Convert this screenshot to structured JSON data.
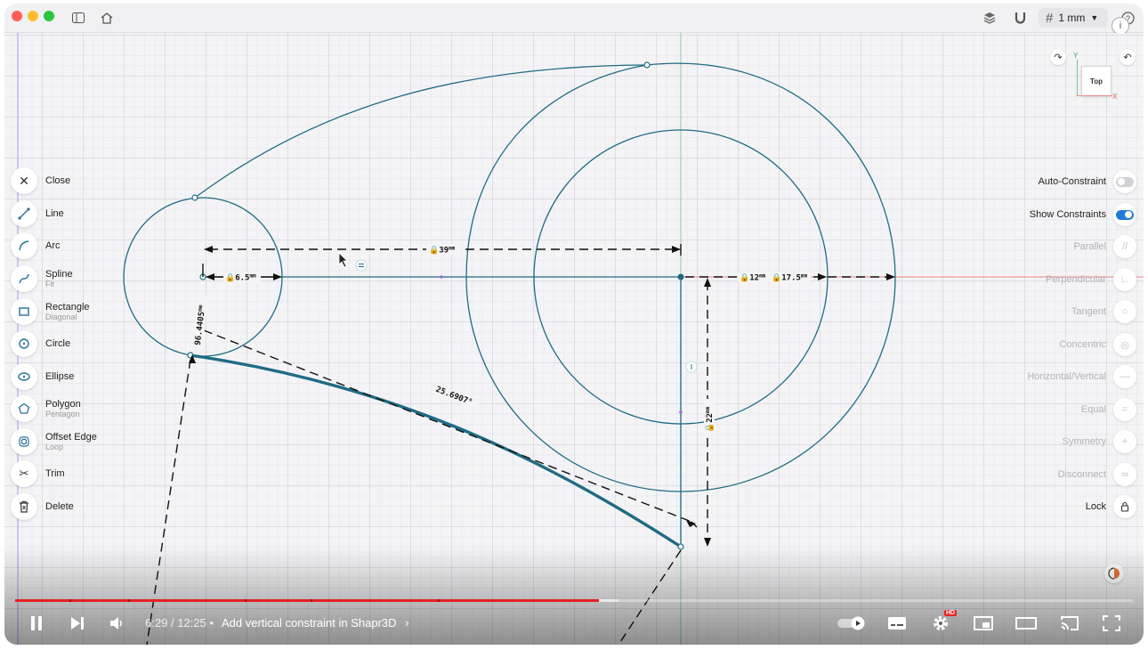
{
  "app": {
    "grid_size_label": "1 mm",
    "info_label": "i",
    "view_cube_label": "Top",
    "axis_y_label": "Y",
    "axis_x_label": "X"
  },
  "tools": [
    {
      "label": "Close",
      "sub": "",
      "icon": "close-icon"
    },
    {
      "label": "Line",
      "sub": "",
      "icon": "line-icon"
    },
    {
      "label": "Arc",
      "sub": "",
      "icon": "arc-icon"
    },
    {
      "label": "Spline",
      "sub": "Fit",
      "icon": "spline-icon"
    },
    {
      "label": "Rectangle",
      "sub": "Diagonal",
      "icon": "rectangle-icon"
    },
    {
      "label": "Circle",
      "sub": "",
      "icon": "circle-icon"
    },
    {
      "label": "Ellipse",
      "sub": "",
      "icon": "ellipse-icon"
    },
    {
      "label": "Polygon",
      "sub": "Pentagon",
      "icon": "polygon-icon"
    },
    {
      "label": "Offset Edge",
      "sub": "Loop",
      "icon": "offset-edge-icon"
    },
    {
      "label": "Trim",
      "sub": "",
      "icon": "trim-icon"
    },
    {
      "label": "Delete",
      "sub": "",
      "icon": "delete-icon"
    }
  ],
  "settings": {
    "auto_constraint": {
      "label": "Auto-Constraint",
      "on": false
    },
    "show_constraints": {
      "label": "Show Constraints",
      "on": true
    }
  },
  "constraints": [
    {
      "label": "Parallel",
      "icon": "parallel-icon",
      "enabled": false
    },
    {
      "label": "Perpendicular",
      "icon": "perpendicular-icon",
      "enabled": false
    },
    {
      "label": "Tangent",
      "icon": "tangent-icon",
      "enabled": false
    },
    {
      "label": "Concentric",
      "icon": "concentric-icon",
      "enabled": false
    },
    {
      "label": "Horizontal/Vertical",
      "icon": "horizontal-vertical-icon",
      "enabled": false
    },
    {
      "label": "Equal",
      "icon": "equal-icon",
      "enabled": false
    },
    {
      "label": "Symmetry",
      "icon": "symmetry-icon",
      "enabled": false
    },
    {
      "label": "Disconnect",
      "icon": "disconnect-icon",
      "enabled": false
    },
    {
      "label": "Lock",
      "icon": "lock-icon",
      "enabled": true
    }
  ],
  "dimensions": {
    "horizontal_39": "39",
    "radius_6_5": "6.5",
    "radius_12": "12",
    "radius_17_5": "17.5",
    "vertical_22": "22",
    "length_96": "96.4405",
    "angle_25": "25.6907°",
    "unit": "mm"
  },
  "player": {
    "current_time": "6:29",
    "duration": "12:25",
    "separator": "/",
    "chapter_title": "Add vertical constraint in Shapr3D",
    "progress_fraction": 0.522,
    "hd_badge": "HD"
  },
  "colors": {
    "sketch_line": "#1f6b84",
    "progress": "#e52222",
    "toggle_on": "#1f7ad6"
  }
}
